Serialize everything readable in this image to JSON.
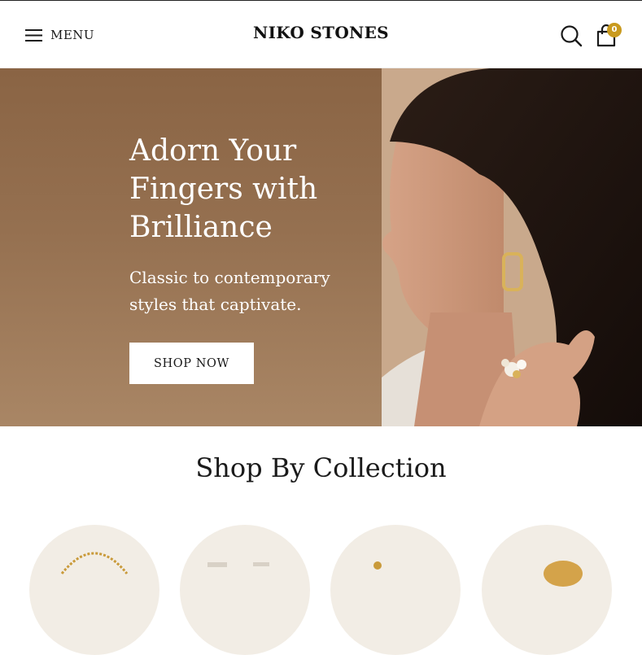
{
  "header": {
    "menu_label": "MENU",
    "logo": "NIKO STONES",
    "cart_count": "0",
    "icons": [
      "hamburger-icon",
      "search-icon",
      "shopping-bag-icon"
    ]
  },
  "hero": {
    "title": "Adorn Your Fingers with Brilliance",
    "subtitle": "Classic to contemporary styles that captivate.",
    "cta_label": "SHOP NOW"
  },
  "collections": {
    "title": "Shop By Collection",
    "items": [
      "collection-necklaces",
      "collection-rings",
      "collection-earrings",
      "collection-bracelets"
    ]
  },
  "colors": {
    "accent": "#c99a1e",
    "hero_bg": "#957050",
    "circle_bg": "#f2ede5"
  }
}
